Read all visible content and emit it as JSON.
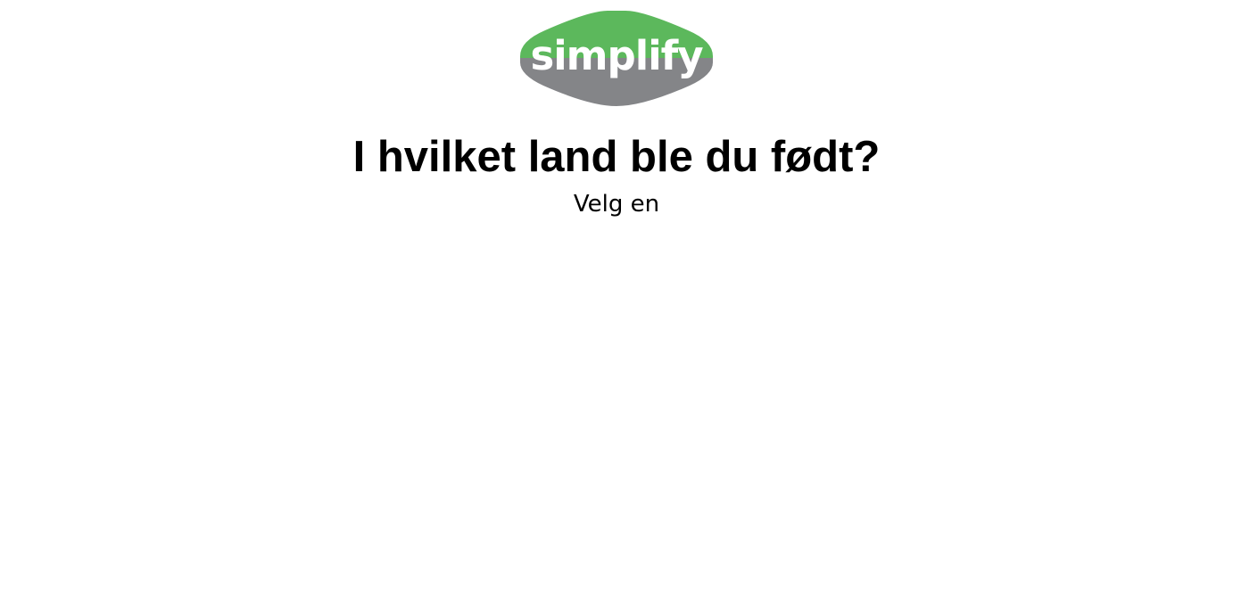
{
  "logo": {
    "text": "simplify",
    "colors": {
      "top": "#5cb85c",
      "bottom": "#848588",
      "text": "#ffffff"
    }
  },
  "question": {
    "title": "I hvilket land ble du født?",
    "hint": "Velg en"
  }
}
